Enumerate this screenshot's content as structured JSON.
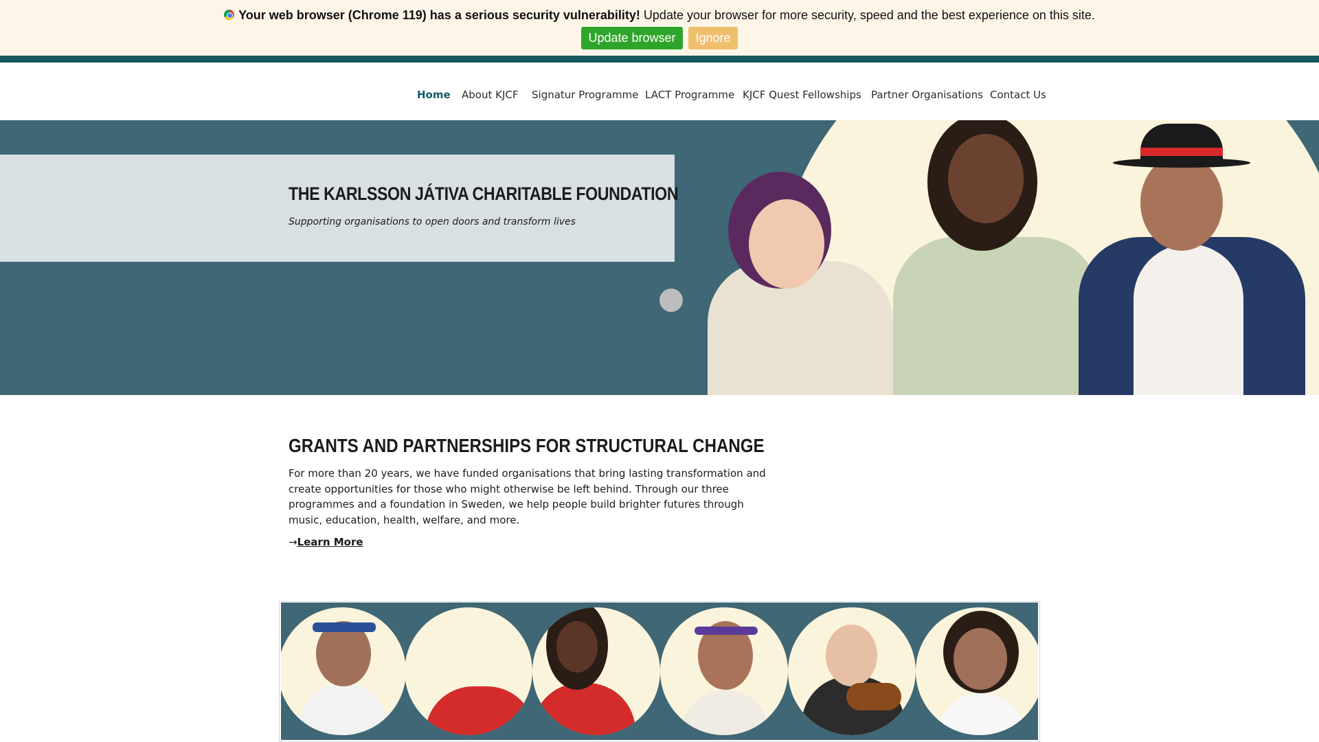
{
  "update_bar": {
    "warning_bold": "Your web browser (Chrome 119) has a serious security vulnerability!",
    "warning_text": " Update your browser for more security, speed and the best experience on this site.",
    "update_button": "Update browser",
    "ignore_button": "Ignore",
    "icon": "chrome-icon"
  },
  "nav": {
    "items": [
      {
        "label": "Home",
        "active": true
      },
      {
        "label": "About KJCF"
      },
      {
        "label": "Signatur Programme"
      },
      {
        "label": "LACT Programme"
      },
      {
        "label": "KJCF Quest Fellowships"
      },
      {
        "label": "Partner Organisations"
      },
      {
        "label": "Contact Us"
      }
    ]
  },
  "hero": {
    "title": "THE KARLSSON JÁTIVA CHARITABLE FOUNDATION",
    "subtitle": "Supporting organisations to open doors and transform lives"
  },
  "intro": {
    "heading": "GRANTS AND PARTNERSHIPS FOR STRUCTURAL CHANGE",
    "body": "For more than 20 years, we have funded organisations that bring lasting transformation and create opportunities for those who might otherwise be left behind. Through our three programmes and a foundation in Sweden, we help people build brighter futures through music, education, health, welfare, and more.",
    "arrow": "→",
    "link": "Learn More"
  },
  "colors": {
    "brand_teal": "#13585d",
    "hero_bg": "#3f6775",
    "title_box": "#d8e0e4",
    "cream": "#fbf4dc",
    "active_nav": "#105a6a",
    "update_green": "#2ea52a",
    "ignore_orange": "#f0bf6e"
  }
}
